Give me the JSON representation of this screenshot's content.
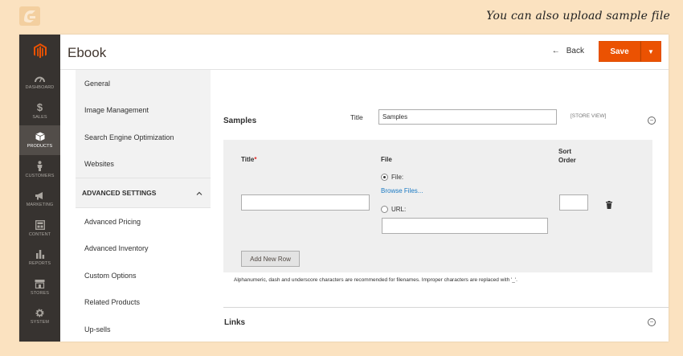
{
  "caption": "You can also upload sample file",
  "nav": {
    "items": [
      {
        "label": "DASHBOARD",
        "icon": "dashboard-icon"
      },
      {
        "label": "SALES",
        "icon": "dollar-icon"
      },
      {
        "label": "PRODUCTS",
        "icon": "cube-icon"
      },
      {
        "label": "CUSTOMERS",
        "icon": "person-icon"
      },
      {
        "label": "MARKETING",
        "icon": "megaphone-icon"
      },
      {
        "label": "CONTENT",
        "icon": "content-icon"
      },
      {
        "label": "REPORTS",
        "icon": "bar-chart-icon"
      },
      {
        "label": "STORES",
        "icon": "store-icon"
      },
      {
        "label": "SYSTEM",
        "icon": "gear-icon"
      }
    ],
    "active": "PRODUCTS"
  },
  "header": {
    "title": "Ebook",
    "back_label": "Back",
    "save_label": "Save"
  },
  "sidebar": {
    "items": [
      "General",
      "Image Management",
      "Search Engine Optimization",
      "Websites"
    ],
    "advanced_heading": "ADVANCED SETTINGS",
    "advanced_items": [
      "Advanced Pricing",
      "Advanced Inventory",
      "Custom Options",
      "Related Products",
      "Up-sells"
    ]
  },
  "samples": {
    "section_title": "Samples",
    "title_label": "Title",
    "title_value": "Samples",
    "store_view": "[STORE VIEW]",
    "grid": {
      "col_title": "Title",
      "required_mark": "*",
      "col_file": "File",
      "col_sort": "Sort\nOrder",
      "radio_file": "File:",
      "browse": "Browse Files...",
      "radio_url": "URL:",
      "title_value": "",
      "url_value": "",
      "sort_value": "",
      "add_row": "Add New Row"
    },
    "note": "Alphanumeric, dash and underscore characters are recommended for filenames. Improper characters are replaced with '_'."
  },
  "links": {
    "section_title": "Links"
  },
  "colors": {
    "accent": "#eb5202",
    "nav_bg": "#373330",
    "link": "#1979c3",
    "page_bg": "#fbe2c0"
  }
}
